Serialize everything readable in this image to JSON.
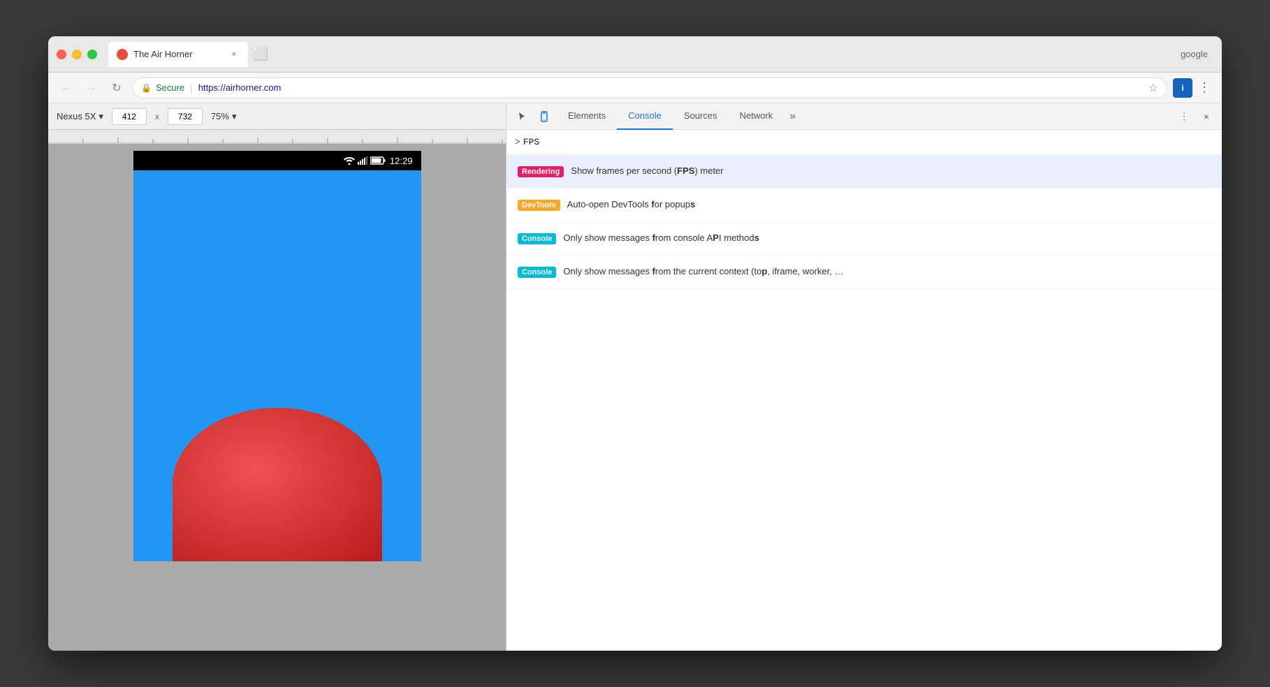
{
  "browser": {
    "traffic_lights": {
      "close": "close",
      "minimize": "minimize",
      "maximize": "maximize"
    },
    "tab": {
      "title": "The Air Horner",
      "close_label": "×"
    },
    "new_tab_icon": "+",
    "google_label": "google",
    "nav": {
      "back_icon": "←",
      "forward_icon": "→",
      "refresh_icon": "↻",
      "lock_icon": "🔒",
      "secure_text": "Secure",
      "url_separator": "|",
      "url": "https://airhorner.com",
      "bookmark_icon": "☆",
      "extension_label": "i",
      "menu_icon": "⋮"
    },
    "device_toolbar": {
      "device_name": "Nexus 5X",
      "chevron": "▾",
      "width": "412",
      "x_label": "x",
      "height": "732",
      "zoom": "75%",
      "zoom_chevron": "▾"
    },
    "phone": {
      "status_time": "12:29",
      "status_icons": [
        "▾▲",
        "▐▌",
        "🔋"
      ]
    }
  },
  "devtools": {
    "icons": {
      "cursor_icon": "⬡",
      "device_icon": "📱"
    },
    "tabs": [
      {
        "label": "Elements",
        "active": false
      },
      {
        "label": "Console",
        "active": true
      },
      {
        "label": "Sources",
        "active": false
      },
      {
        "label": "Network",
        "active": false
      }
    ],
    "more_label": "»",
    "action_dots": "⋮",
    "action_close": "×",
    "console": {
      "prompt": ">",
      "input_text": "FPS"
    },
    "autocomplete": [
      {
        "badge": "Rendering",
        "badge_class": "badge-rendering",
        "text_html": "Show frames per second (<strong>FPS</strong>) meter",
        "highlighted": true
      },
      {
        "badge": "DevTools",
        "badge_class": "badge-devtools",
        "text_html": "Auto-open DevTools <strong>f</strong>or popup<strong>s</strong>",
        "highlighted": false
      },
      {
        "badge": "Console",
        "badge_class": "badge-console",
        "text_html": "Only show messages <strong>f</strong>rom console A<strong>P</strong>I method<strong>s</strong>",
        "highlighted": false
      },
      {
        "badge": "Console",
        "badge_class": "badge-console",
        "text_html": "Only show messages <strong>f</strong>rom the current context (to<strong>p</strong>, iframe, worker, …",
        "highlighted": false
      }
    ]
  }
}
